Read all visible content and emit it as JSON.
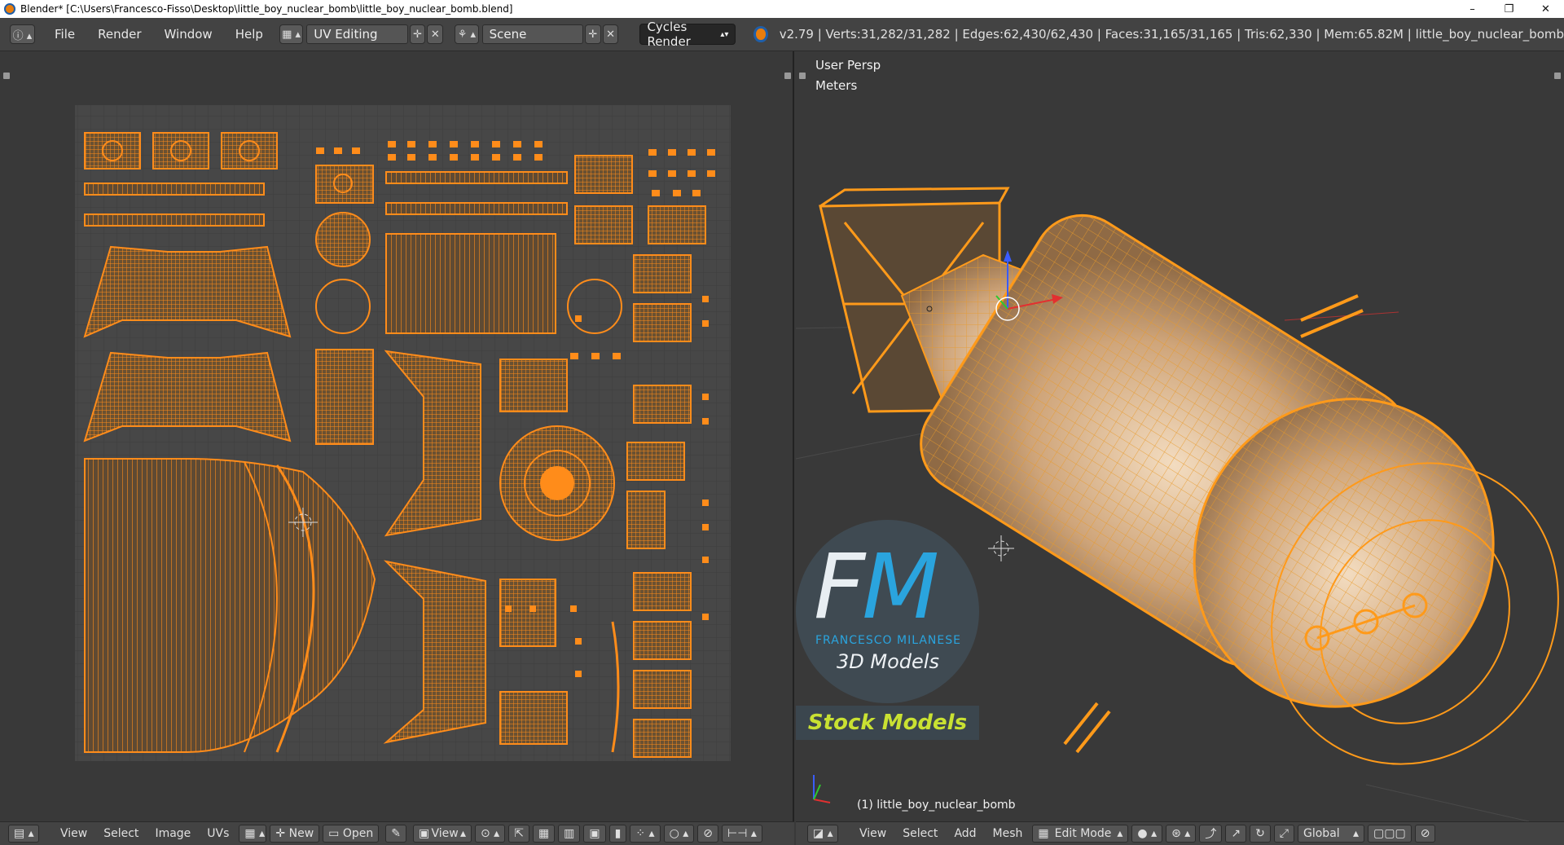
{
  "window": {
    "title": "Blender* [C:\\Users\\Francesco-Fisso\\Desktop\\little_boy_nuclear_bomb\\little_boy_nuclear_bomb.blend]",
    "minimize": "–",
    "maximize": "❐",
    "close": "✕"
  },
  "menu": {
    "file": "File",
    "render": "Render",
    "window": "Window",
    "help": "Help"
  },
  "screen_layout": {
    "value": "UV Editing"
  },
  "scene": {
    "value": "Scene"
  },
  "render_engine": {
    "value": "Cycles Render"
  },
  "stats": "v2.79 | Verts:31,282/31,282 | Edges:62,430/62,430 | Faces:31,165/31,165 | Tris:62,330 | Mem:65.82M | little_boy_nuclear_bomb",
  "viewport": {
    "view_name": "User Persp",
    "units": "Meters",
    "object_label": "(1) little_boy_nuclear_bomb"
  },
  "watermark": {
    "letters_f": "F",
    "letters_m": "M",
    "name": "FRANCESCO MILANESE",
    "subtitle": "3D Models",
    "stock": "Stock Models"
  },
  "uv_header": {
    "view": "View",
    "select": "Select",
    "image": "Image",
    "uvs": "UVs",
    "new": "New",
    "open": "Open",
    "view2": "View"
  },
  "view3d_header": {
    "view": "View",
    "select": "Select",
    "add": "Add",
    "mesh": "Mesh",
    "mode": "Edit Mode",
    "orientation": "Global"
  },
  "colors": {
    "uv_wire": "#ff8c1a",
    "mesh_fill": "#c9a27a",
    "watermark_blue": "#2aa4de",
    "stock_green": "#c9e132"
  }
}
